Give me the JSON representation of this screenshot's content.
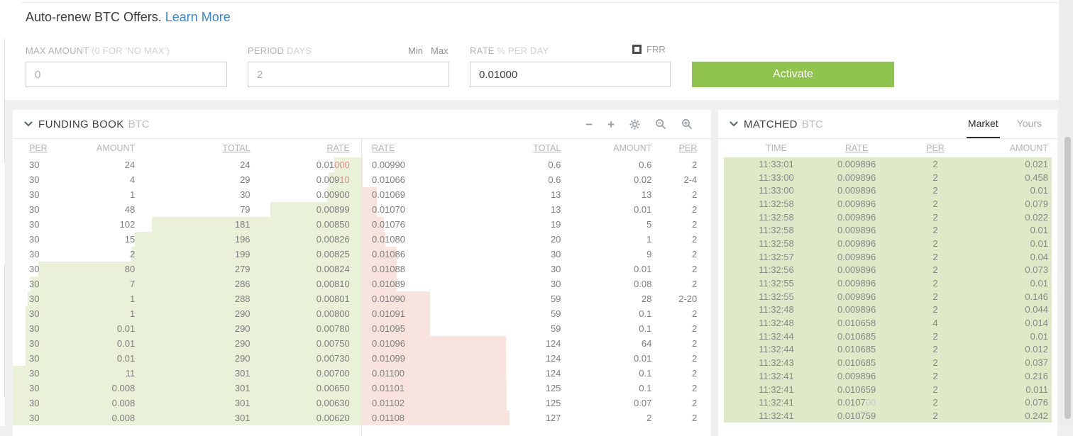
{
  "form": {
    "title": "Auto-renew BTC Offers.",
    "learn_more_label": "Learn More",
    "max_amount": {
      "label": "MAX AMOUNT",
      "label_hint": "(0 FOR 'NO MAX')",
      "value": "0"
    },
    "period": {
      "label": "PERIOD",
      "label_hint": "DAYS",
      "min_label": "Min",
      "max_label": "Max",
      "value": "2"
    },
    "rate": {
      "label": "RATE",
      "label_hint": "% PER DAY",
      "value": "0.01000",
      "frr_label": "FRR"
    },
    "activate_label": "Activate"
  },
  "funding_book": {
    "title": "FUNDING BOOK",
    "currency": "BTC",
    "toolbar_icons": [
      "minus-icon",
      "plus-icon",
      "gear-icon",
      "zoom-out-icon",
      "zoom-in-icon"
    ],
    "bid_columns": [
      "PER",
      "AMOUNT",
      "TOTAL",
      "RATE"
    ],
    "ask_columns": [
      "RATE",
      "TOTAL",
      "AMOUNT",
      "PER"
    ],
    "max_total": 301,
    "bids": [
      {
        "per": "30",
        "amount": "24",
        "total": "24",
        "rate": "0.01",
        "rate_hl": "000"
      },
      {
        "per": "30",
        "amount": "4",
        "total": "29",
        "rate": "0.009",
        "rate_hl": "10"
      },
      {
        "per": "30",
        "amount": "1",
        "total": "30",
        "rate": "0.00900"
      },
      {
        "per": "30",
        "amount": "48",
        "total": "79",
        "rate": "0.00899"
      },
      {
        "per": "30",
        "amount": "102",
        "total": "181",
        "rate": "0.00850"
      },
      {
        "per": "30",
        "amount": "15",
        "total": "196",
        "rate": "0.00826"
      },
      {
        "per": "30",
        "amount": "2",
        "total": "199",
        "rate": "0.00825"
      },
      {
        "per": "30",
        "amount": "80",
        "total": "279",
        "rate": "0.00824"
      },
      {
        "per": "30",
        "amount": "7",
        "total": "286",
        "rate": "0.00810"
      },
      {
        "per": "30",
        "amount": "1",
        "total": "288",
        "rate": "0.00801"
      },
      {
        "per": "30",
        "amount": "1",
        "total": "290",
        "rate": "0.00800"
      },
      {
        "per": "30",
        "amount": "0.01",
        "total": "290",
        "rate": "0.00780"
      },
      {
        "per": "30",
        "amount": "0.01",
        "total": "290",
        "rate": "0.00750"
      },
      {
        "per": "30",
        "amount": "0.01",
        "total": "290",
        "rate": "0.00730"
      },
      {
        "per": "30",
        "amount": "11",
        "total": "301",
        "rate": "0.00700"
      },
      {
        "per": "30",
        "amount": "0.008",
        "total": "301",
        "rate": "0.00650"
      },
      {
        "per": "30",
        "amount": "0.008",
        "total": "301",
        "rate": "0.00630"
      },
      {
        "per": "30",
        "amount": "0.008",
        "total": "301",
        "rate": "0.00620"
      }
    ],
    "asks": [
      {
        "rate": "0.00990",
        "total": "0.6",
        "amount": "0.6",
        "per": "2"
      },
      {
        "rate": "0.01066",
        "total": "0.6",
        "amount": "0.02",
        "per": "2-4"
      },
      {
        "rate": "0.01069",
        "total": "13",
        "amount": "13",
        "per": "2"
      },
      {
        "rate": "0.01070",
        "total": "13",
        "amount": "0.01",
        "per": "2"
      },
      {
        "rate": "0.01076",
        "total": "19",
        "amount": "5",
        "per": "2"
      },
      {
        "rate": "0.01080",
        "total": "20",
        "amount": "1",
        "per": "2"
      },
      {
        "rate": "0.01086",
        "total": "30",
        "amount": "9",
        "per": "2"
      },
      {
        "rate": "0.01088",
        "total": "30",
        "amount": "0.01",
        "per": "2"
      },
      {
        "rate": "0.01089",
        "total": "30",
        "amount": "0.08",
        "per": "2"
      },
      {
        "rate": "0.01090",
        "total": "59",
        "amount": "28",
        "per": "2-20"
      },
      {
        "rate": "0.01091",
        "total": "59",
        "amount": "0.1",
        "per": "2"
      },
      {
        "rate": "0.01095",
        "total": "59",
        "amount": "0.1",
        "per": "2"
      },
      {
        "rate": "0.01096",
        "total": "124",
        "amount": "64",
        "per": "2"
      },
      {
        "rate": "0.01099",
        "total": "124",
        "amount": "0.01",
        "per": "2"
      },
      {
        "rate": "0.01100",
        "total": "124",
        "amount": "0.1",
        "per": "2"
      },
      {
        "rate": "0.01101",
        "total": "125",
        "amount": "0.1",
        "per": "2"
      },
      {
        "rate": "0.01102",
        "total": "125",
        "amount": "0.07",
        "per": "2"
      },
      {
        "rate": "0.01108",
        "total": "127",
        "amount": "2",
        "per": "2"
      }
    ]
  },
  "matched": {
    "title": "MATCHED",
    "currency": "BTC",
    "tabs": [
      {
        "label": "Market"
      },
      {
        "label": "Yours"
      }
    ],
    "active_tab": "Market",
    "columns": [
      "TIME",
      "RATE",
      "PER",
      "AMOUNT"
    ],
    "trades": [
      {
        "time": "11:33:01",
        "rate": "0.009896",
        "per": "2",
        "amount": "0.021"
      },
      {
        "time": "11:33:00",
        "rate": "0.009896",
        "per": "2",
        "amount": "0.458"
      },
      {
        "time": "11:33:00",
        "rate": "0.009896",
        "per": "2",
        "amount": "0.01"
      },
      {
        "time": "11:32:58",
        "rate": "0.009896",
        "per": "2",
        "amount": "0.079"
      },
      {
        "time": "11:32:58",
        "rate": "0.009896",
        "per": "2",
        "amount": "0.022"
      },
      {
        "time": "11:32:58",
        "rate": "0.009896",
        "per": "2",
        "amount": "0.01"
      },
      {
        "time": "11:32:58",
        "rate": "0.009896",
        "per": "2",
        "amount": "0.01"
      },
      {
        "time": "11:32:57",
        "rate": "0.009896",
        "per": "2",
        "amount": "0.04"
      },
      {
        "time": "11:32:56",
        "rate": "0.009896",
        "per": "2",
        "amount": "0.073"
      },
      {
        "time": "11:32:55",
        "rate": "0.009896",
        "per": "2",
        "amount": "0.01"
      },
      {
        "time": "11:32:55",
        "rate": "0.009896",
        "per": "2",
        "amount": "0.146"
      },
      {
        "time": "11:32:48",
        "rate": "0.009896",
        "per": "2",
        "amount": "0.044"
      },
      {
        "time": "11:32:48",
        "rate": "0.010658",
        "per": "4",
        "amount": "0.014"
      },
      {
        "time": "11:32:44",
        "rate": "0.010685",
        "per": "2",
        "amount": "0.01"
      },
      {
        "time": "11:32:44",
        "rate": "0.010685",
        "per": "2",
        "amount": "0.012"
      },
      {
        "time": "11:32:43",
        "rate": "0.010685",
        "per": "2",
        "amount": "0.037"
      },
      {
        "time": "11:32:41",
        "rate": "0.009896",
        "per": "2",
        "amount": "0.216"
      },
      {
        "time": "11:32:41",
        "rate": "0.010659",
        "per": "2",
        "amount": "0.011"
      },
      {
        "time": "11:32:41",
        "rate": "0.0107",
        "rate_dim": "00",
        "per": "2",
        "amount": "0.076"
      },
      {
        "time": "11:32:41",
        "rate": "0.010759",
        "per": "2",
        "amount": "0.242"
      }
    ]
  },
  "colors": {
    "activate_green": "#8fc54c",
    "link_blue": "#3e85c6",
    "depth_bid_green": "#e9f2d9",
    "depth_ask_pink": "#f8e3df",
    "matched_row_green": "#dde9c7",
    "rate_flash_red": "#dc8f85",
    "rate_dim_grey": "#c9c9c9"
  }
}
